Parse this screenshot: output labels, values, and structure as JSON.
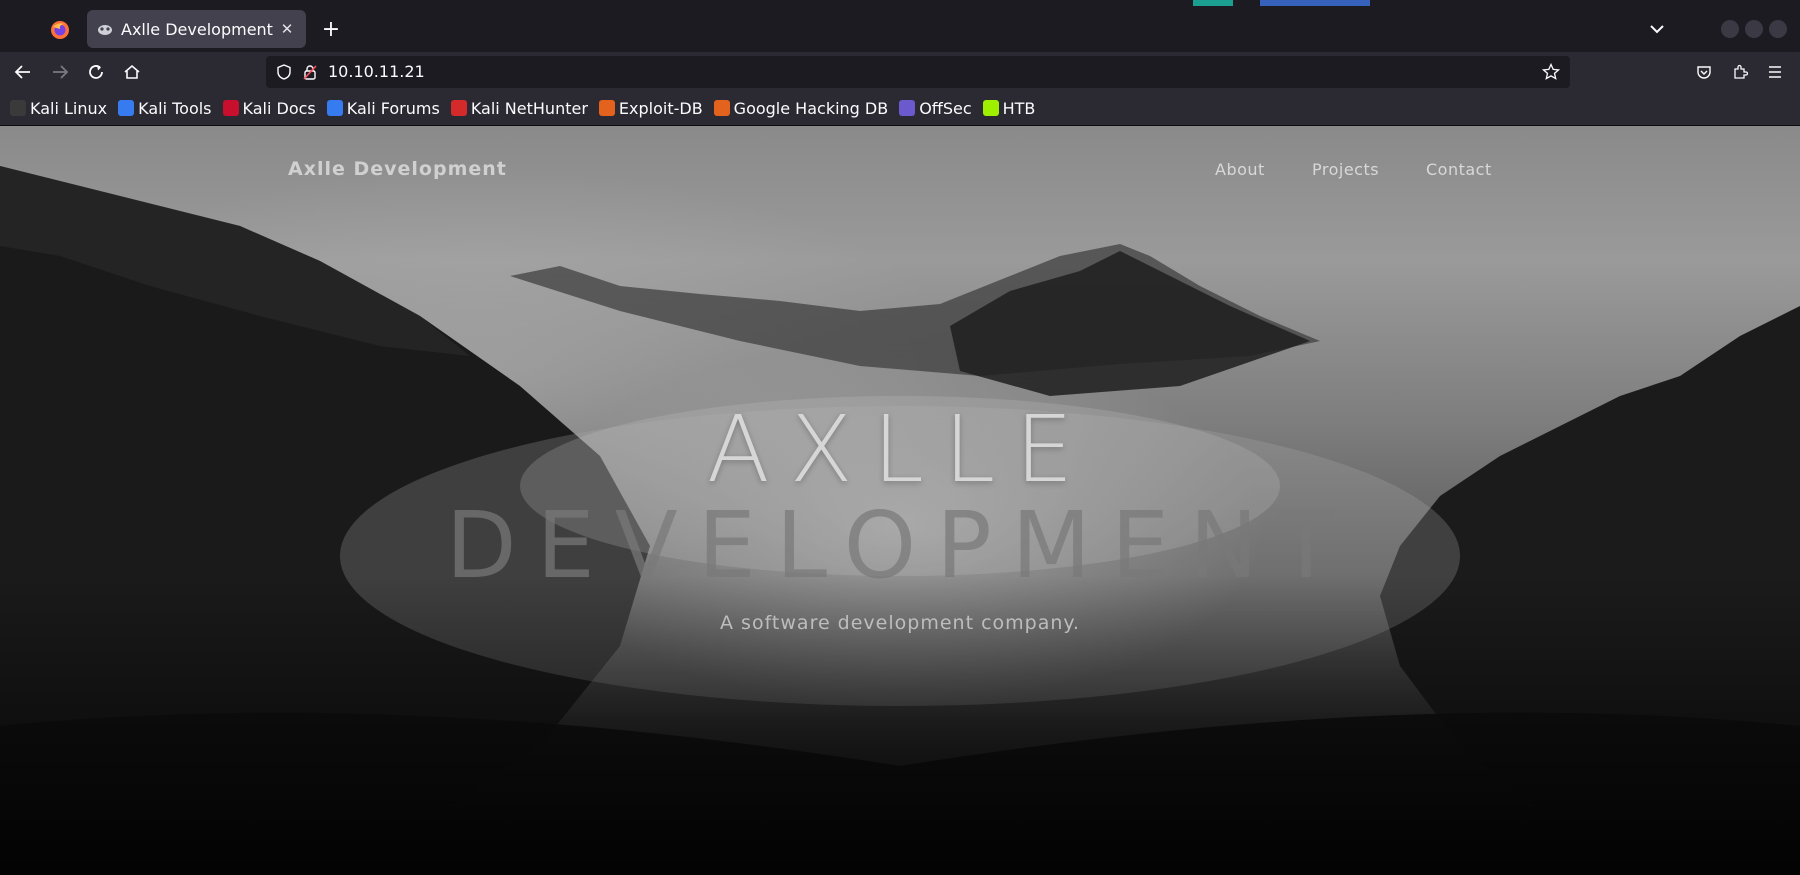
{
  "browser": {
    "tab": {
      "title": "Axlle Development"
    },
    "new_tab_label": "+",
    "url": "10.10.11.21"
  },
  "bookmarks": [
    {
      "label": "Kali Linux",
      "icon": "kali-dragon-icon",
      "color": "#3a3a3a"
    },
    {
      "label": "Kali Tools",
      "icon": "kali-tools-icon",
      "color": "#367bf0"
    },
    {
      "label": "Kali Docs",
      "icon": "kali-docs-icon",
      "color": "#c8102e"
    },
    {
      "label": "Kali Forums",
      "icon": "kali-forums-icon",
      "color": "#367bf0"
    },
    {
      "label": "Kali NetHunter",
      "icon": "nethunter-icon",
      "color": "#d42a2a"
    },
    {
      "label": "Exploit-DB",
      "icon": "exploit-db-icon",
      "color": "#e2621e"
    },
    {
      "label": "Google Hacking DB",
      "icon": "ghdb-icon",
      "color": "#e2621e"
    },
    {
      "label": "OffSec",
      "icon": "offsec-icon",
      "color": "#6a5acd"
    },
    {
      "label": "HTB",
      "icon": "htb-cube-icon",
      "color": "#9fef00"
    }
  ],
  "site": {
    "brand": "Axlle Development",
    "nav": [
      "About",
      "Projects",
      "Contact"
    ],
    "hero_line1": "AXLLE",
    "hero_line2": "DEVELOPMENT",
    "tagline": "A software development company."
  }
}
